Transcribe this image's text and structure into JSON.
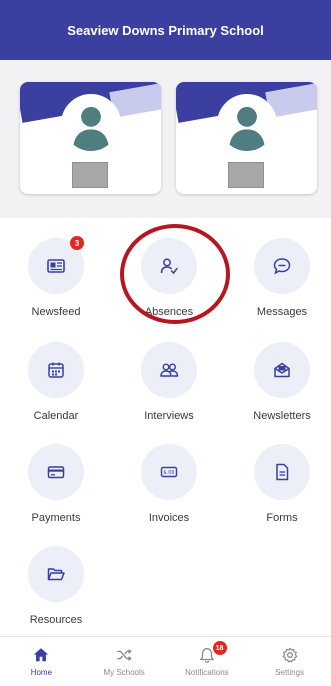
{
  "header": {
    "title": "Seaview Downs Primary School"
  },
  "colors": {
    "brand": "#3a3fa0",
    "badge": "#e0281e",
    "highlight": "#b5171f",
    "tile_bg": "#eceef8"
  },
  "students": [
    {
      "photo_icon": "person-silhouette-icon"
    },
    {
      "photo_icon": "person-silhouette-icon"
    }
  ],
  "menu": {
    "newsfeed": {
      "label": "Newsfeed",
      "icon": "newspaper-icon",
      "badge": "3"
    },
    "absences": {
      "label": "Absences",
      "icon": "user-check-icon"
    },
    "messages": {
      "label": "Messages",
      "icon": "chat-bubble-icon"
    },
    "calendar": {
      "label": "Calendar",
      "icon": "calendar-icon"
    },
    "interviews": {
      "label": "Interviews",
      "icon": "users-icon"
    },
    "newsletters": {
      "label": "Newsletters",
      "icon": "envelope-open-icon"
    },
    "payments": {
      "label": "Payments",
      "icon": "credit-card-icon"
    },
    "invoices": {
      "label": "Invoices",
      "icon": "invoice-icon"
    },
    "forms": {
      "label": "Forms",
      "icon": "document-icon"
    },
    "resources": {
      "label": "Resources",
      "icon": "folder-open-icon"
    }
  },
  "nav": {
    "home": {
      "label": "Home",
      "icon": "home-icon"
    },
    "schools": {
      "label": "My Schools",
      "icon": "shuffle-icon"
    },
    "notifications": {
      "label": "Notifications",
      "icon": "bell-icon",
      "badge": "18"
    },
    "settings": {
      "label": "Settings",
      "icon": "gear-icon"
    }
  }
}
